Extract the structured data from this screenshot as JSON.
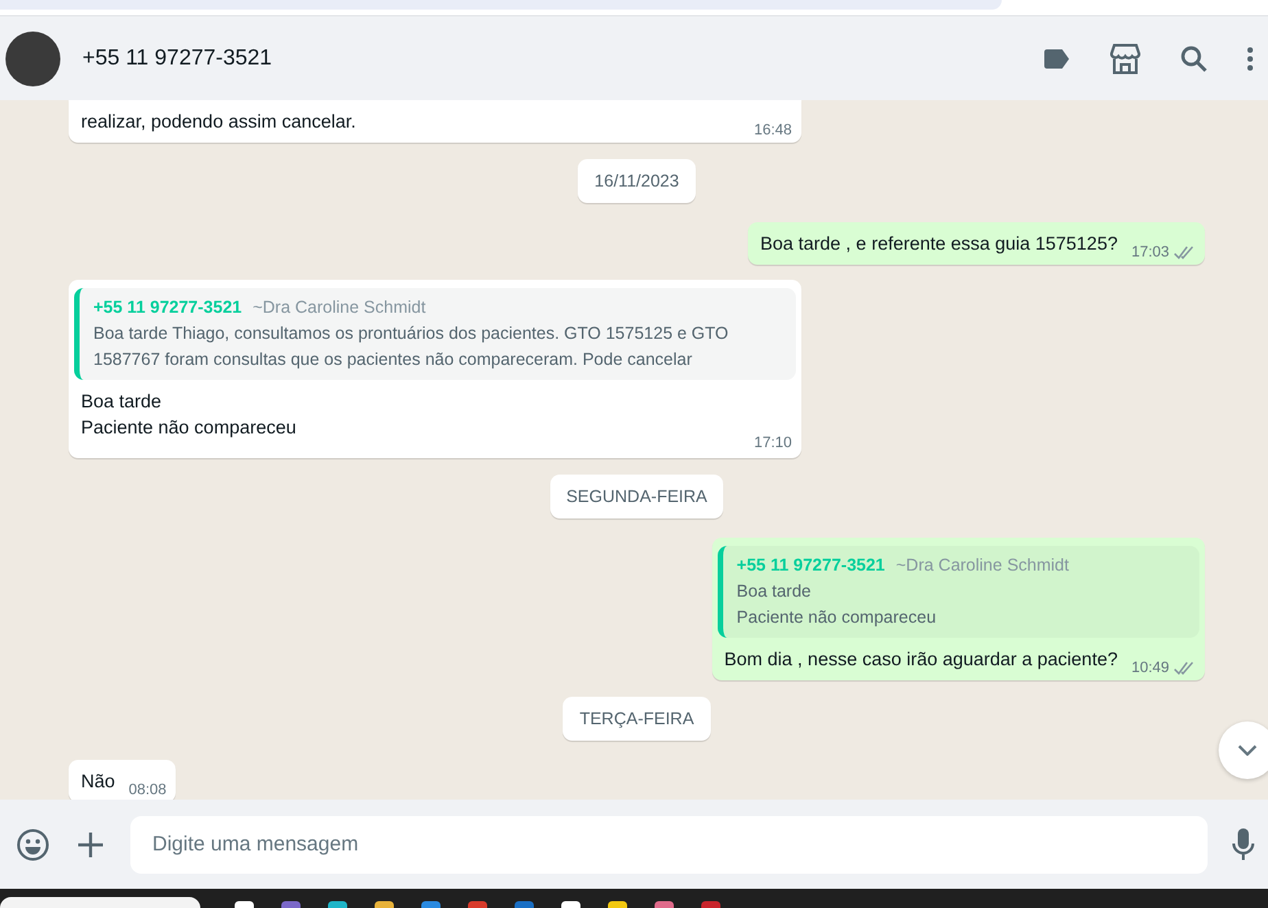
{
  "header": {
    "contact": "+55 11 97277-3521"
  },
  "messages": [
    {
      "kind": "incoming",
      "clipped": true,
      "text": "realizar, podendo assim cancelar.",
      "time": "16:48"
    },
    {
      "kind": "date",
      "text": "16/11/2023"
    },
    {
      "kind": "outgoing",
      "text": "Boa tarde , e referente essa guia 1575125?",
      "time": "17:03"
    },
    {
      "kind": "incoming",
      "quote": {
        "author": "+55 11 97277-3521",
        "alias": "~Dra Caroline Schmidt",
        "lines": [
          "Boa tarde Thiago, consultamos os prontuários dos pacientes. GTO 1575125 e GTO 1587767 foram consultas que os pacientes não compareceram. Pode cancelar"
        ]
      },
      "lines": [
        "Boa tarde",
        "Paciente não compareceu"
      ],
      "time": "17:10"
    },
    {
      "kind": "date",
      "text": "SEGUNDA-FEIRA"
    },
    {
      "kind": "outgoing",
      "quote": {
        "author": "+55 11 97277-3521",
        "alias": "~Dra Caroline Schmidt",
        "lines": [
          "Boa tarde",
          "Paciente não compareceu"
        ]
      },
      "text": "Bom dia , nesse caso irão aguardar a paciente?",
      "time": "10:49"
    },
    {
      "kind": "date",
      "text": "TERÇA-FEIRA"
    },
    {
      "kind": "incoming",
      "text": "Não",
      "time": "08:08"
    }
  ],
  "composer": {
    "placeholder": "Digite uma mensagem"
  }
}
